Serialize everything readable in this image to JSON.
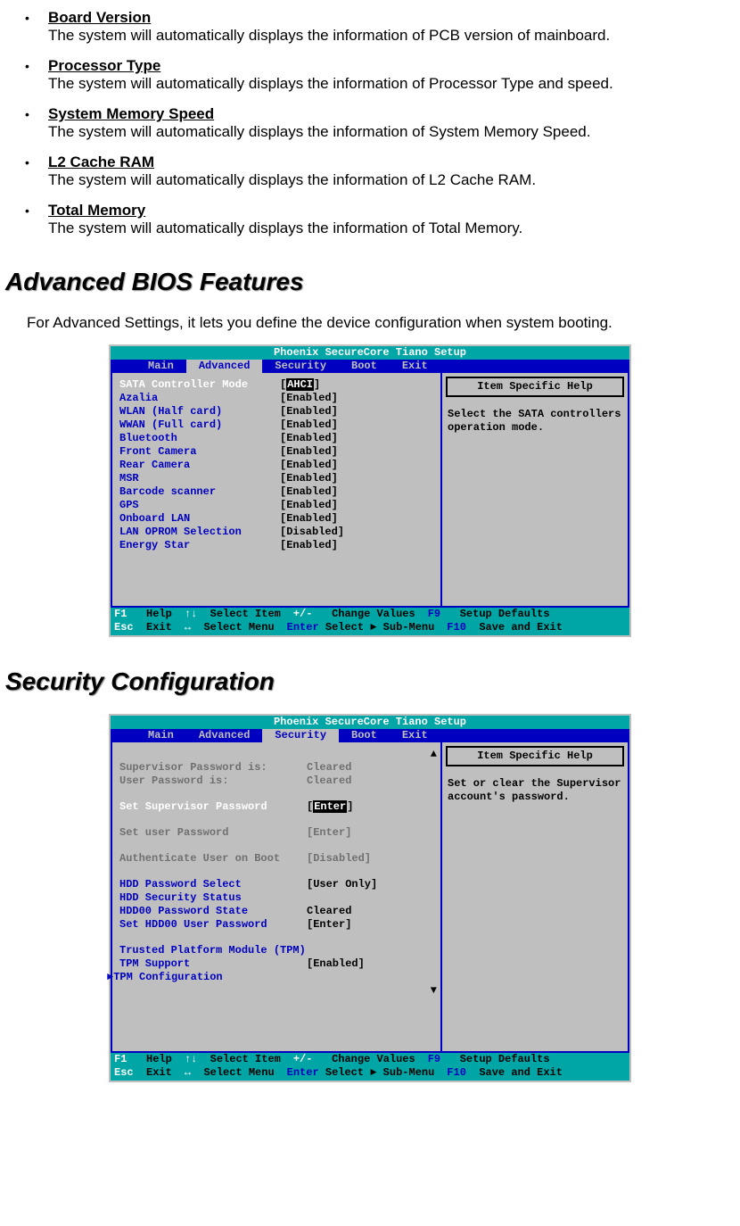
{
  "bullets": [
    {
      "title": "Board Version",
      "desc": "The system will automatically displays the information of PCB version of mainboard."
    },
    {
      "title": "Processor Type",
      "desc": "The system will automatically displays the information of Processor Type and speed."
    },
    {
      "title": "System Memory Speed",
      "desc": "The system will automatically displays the information of System Memory Speed."
    },
    {
      "title": "L2 Cache RAM",
      "desc": "The system will automatically displays the information of L2 Cache RAM."
    },
    {
      "title": "Total Memory",
      "desc": "The system will automatically displays the information of Total Memory."
    }
  ],
  "section1": {
    "heading": "Advanced BIOS Features",
    "intro": "For Advanced Settings, it lets you define the device configuration when system booting."
  },
  "section2": {
    "heading": "Security Configuration"
  },
  "bios_common": {
    "title": "Phoenix SecureCore Tiano Setup",
    "tabs": [
      "Main",
      "Advanced",
      "Security",
      "Boot",
      "Exit"
    ],
    "help_box": "Item Specific Help",
    "footer": {
      "r1": {
        "f1": "F1",
        "help": "Help",
        "ud": "↑↓",
        "sel_item": "Select Item",
        "pm": "+/-",
        "chg": "Change Values",
        "f9": "F9",
        "defs": "Setup Defaults"
      },
      "r2": {
        "esc": "Esc",
        "exit": "Exit",
        "lr": "↔",
        "sel_menu": "Select Menu",
        "ent": "Enter",
        "sub": "Select ► Sub-Menu",
        "f10": "F10",
        "save": "Save and Exit"
      }
    }
  },
  "adv": {
    "help": "Select the SATA controllers operation mode.",
    "rows": [
      {
        "lbl": "SATA Controller Mode",
        "val": "AHCI",
        "sel": true
      },
      {
        "lbl": "Azalia",
        "val": "[Enabled]"
      },
      {
        "lbl": "WLAN (Half card)",
        "val": "[Enabled]"
      },
      {
        "lbl": "WWAN (Full card)",
        "val": "[Enabled]"
      },
      {
        "lbl": "Bluetooth",
        "val": "[Enabled]"
      },
      {
        "lbl": "Front Camera",
        "val": "[Enabled]"
      },
      {
        "lbl": "Rear Camera",
        "val": "[Enabled]"
      },
      {
        "lbl": "MSR",
        "val": "[Enabled]"
      },
      {
        "lbl": "Barcode scanner",
        "val": "[Enabled]"
      },
      {
        "lbl": "GPS",
        "val": "[Enabled]"
      },
      {
        "lbl": "Onboard LAN",
        "val": "[Enabled]"
      },
      {
        "lbl": "LAN OPROM Selection",
        "val": "[Disabled]"
      },
      {
        "lbl": "Energy Star",
        "val": "[Enabled]"
      }
    ]
  },
  "sec": {
    "help": "Set or clear the Supervisor account's password.",
    "rows": [
      {
        "lbl": "Supervisor Password is:",
        "val": "Cleared",
        "gray": true
      },
      {
        "lbl": "User Password is:",
        "val": "Cleared",
        "gray": true
      },
      {
        "spacer": true
      },
      {
        "lbl": "Set Supervisor Password",
        "val": "Enter",
        "sel": true,
        "brackets": true
      },
      {
        "spacer": true
      },
      {
        "lbl": "Set user Password",
        "val": "[Enter]",
        "gray": true
      },
      {
        "spacer": true
      },
      {
        "lbl": "Authenticate User on Boot",
        "val": "[Disabled]",
        "gray": true
      },
      {
        "spacer": true
      },
      {
        "lbl": "HDD Password Select",
        "val": "[User Only]"
      },
      {
        "lbl": "HDD Security Status",
        "val": ""
      },
      {
        "lbl": "HDD00 Password State",
        "val": "Cleared",
        "valblack": true
      },
      {
        "lbl": "Set HDD00 User Password",
        "val": "[Enter]"
      },
      {
        "spacer": true
      },
      {
        "lbl": "Trusted Platform Module (TPM)",
        "val": ""
      },
      {
        "lbl": "TPM Support",
        "val": "[Enabled]"
      },
      {
        "lbl": "TPM Configuration",
        "val": "",
        "sub": true
      }
    ]
  }
}
